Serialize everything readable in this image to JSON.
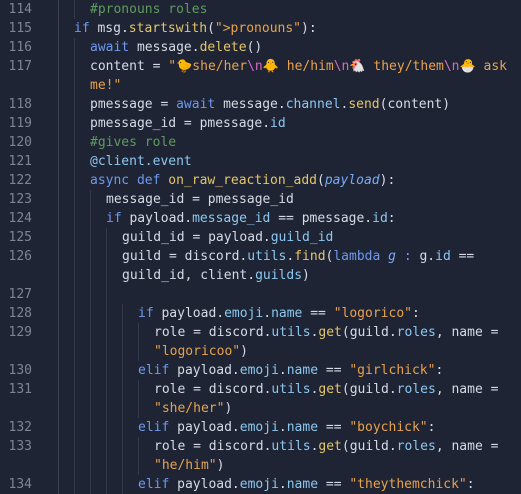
{
  "colors": {
    "background": "#1e2433",
    "line_number": "#7d8595",
    "text": "#d5dbe5",
    "comment": "#5f9a5f",
    "keyword": "#6f98ee",
    "function": "#e4c56b",
    "string": "#e8a24e",
    "escape": "#d768c7",
    "attribute": "#8cc7f0"
  },
  "lines": [
    {
      "n": "114",
      "indent": 1,
      "tokens": [
        [
          "#pronouns roles",
          "comment"
        ]
      ]
    },
    {
      "n": "115",
      "indent": 0,
      "tokens": [
        [
          "if ",
          "kw"
        ],
        [
          "msg.",
          "text"
        ],
        [
          "startswith",
          "fn"
        ],
        [
          "(",
          "text"
        ],
        [
          "\">pronouns\"",
          "str"
        ],
        [
          "):",
          "text"
        ]
      ]
    },
    {
      "n": "116",
      "indent": 1,
      "tokens": [
        [
          "await ",
          "kw"
        ],
        [
          "message.",
          "text"
        ],
        [
          "delete",
          "fn"
        ],
        [
          "()",
          "text"
        ]
      ]
    },
    {
      "n": "117",
      "indent": 1,
      "tokens": [
        [
          "content ",
          "text"
        ],
        [
          "= ",
          "op"
        ],
        [
          "\"🐤she/her",
          "str"
        ],
        [
          "\\n",
          "esc"
        ],
        [
          "🐥 he/him",
          "str"
        ],
        [
          "\\n",
          "esc"
        ],
        [
          "🐔 they/them",
          "str"
        ],
        [
          "\\n",
          "esc"
        ],
        [
          "🐣 ask",
          "str"
        ]
      ]
    },
    {
      "n": "",
      "indent": 1,
      "tokens": [
        [
          "me!\"",
          "str"
        ]
      ]
    },
    {
      "n": "118",
      "indent": 1,
      "tokens": [
        [
          "pmessage ",
          "text"
        ],
        [
          "= ",
          "op"
        ],
        [
          "await ",
          "kw"
        ],
        [
          "message.",
          "text"
        ],
        [
          "channel",
          "attr"
        ],
        [
          ".",
          "text"
        ],
        [
          "send",
          "fn"
        ],
        [
          "(content)",
          "text"
        ]
      ]
    },
    {
      "n": "119",
      "indent": 1,
      "tokens": [
        [
          "pmessage_id ",
          "text"
        ],
        [
          "= ",
          "op"
        ],
        [
          "pmessage.",
          "text"
        ],
        [
          "id",
          "attr"
        ]
      ]
    },
    {
      "n": "120",
      "indent": 1,
      "tokens": [
        [
          "#gives role",
          "comment"
        ]
      ]
    },
    {
      "n": "121",
      "indent": 1,
      "tokens": [
        [
          "@client.event",
          "attr"
        ]
      ]
    },
    {
      "n": "122",
      "indent": 1,
      "tokens": [
        [
          "async ",
          "kw"
        ],
        [
          "def ",
          "kw"
        ],
        [
          "on_raw_reaction_add",
          "fn"
        ],
        [
          "(",
          "text"
        ],
        [
          "payload",
          "ital"
        ],
        [
          "):",
          "text"
        ]
      ]
    },
    {
      "n": "123",
      "indent": 2,
      "tokens": [
        [
          "message_id ",
          "text"
        ],
        [
          "= ",
          "op"
        ],
        [
          "pmessage_id",
          "text"
        ]
      ]
    },
    {
      "n": "124",
      "indent": 2,
      "tokens": [
        [
          "if ",
          "kw"
        ],
        [
          "payload.",
          "text"
        ],
        [
          "message_id ",
          "attr"
        ],
        [
          "== ",
          "op"
        ],
        [
          "pmessage.",
          "text"
        ],
        [
          "id",
          "attr"
        ],
        [
          ":",
          "text"
        ]
      ]
    },
    {
      "n": "125",
      "indent": 3,
      "tokens": [
        [
          "guild_id ",
          "text"
        ],
        [
          "= ",
          "op"
        ],
        [
          "payload.",
          "text"
        ],
        [
          "guild_id",
          "attr"
        ]
      ]
    },
    {
      "n": "126",
      "indent": 3,
      "tokens": [
        [
          "guild ",
          "text"
        ],
        [
          "= ",
          "op"
        ],
        [
          "discord.",
          "text"
        ],
        [
          "utils",
          "attr"
        ],
        [
          ".",
          "text"
        ],
        [
          "find",
          "fn"
        ],
        [
          "(",
          "text"
        ],
        [
          "lambda ",
          "kw"
        ],
        [
          "g ",
          "ital"
        ],
        [
          ": ",
          "kw"
        ],
        [
          "g.",
          "text"
        ],
        [
          "id ",
          "attr"
        ],
        [
          "==",
          "op"
        ]
      ]
    },
    {
      "n": "",
      "indent": 3,
      "tokens": [
        [
          "guild_id, client.",
          "text"
        ],
        [
          "guilds",
          "attr"
        ],
        [
          ")",
          "text"
        ]
      ]
    },
    {
      "n": "127",
      "indent": 3,
      "tokens": []
    },
    {
      "n": "128",
      "indent": 4,
      "tokens": [
        [
          "if ",
          "kw"
        ],
        [
          "payload.",
          "text"
        ],
        [
          "emoji",
          "attr"
        ],
        [
          ".",
          "text"
        ],
        [
          "name ",
          "attr"
        ],
        [
          "== ",
          "op"
        ],
        [
          "\"logorico\"",
          "str"
        ],
        [
          ":",
          "text"
        ]
      ]
    },
    {
      "n": "129",
      "indent": 5,
      "tokens": [
        [
          "role ",
          "text"
        ],
        [
          "= ",
          "op"
        ],
        [
          "discord.",
          "text"
        ],
        [
          "utils",
          "attr"
        ],
        [
          ".",
          "text"
        ],
        [
          "get",
          "fn"
        ],
        [
          "(guild.",
          "text"
        ],
        [
          "roles",
          "attr"
        ],
        [
          ", name ",
          "text"
        ],
        [
          "=",
          "op"
        ]
      ]
    },
    {
      "n": "",
      "indent": 5,
      "tokens": [
        [
          "\"logoricoo\"",
          "str"
        ],
        [
          ")",
          "text"
        ]
      ]
    },
    {
      "n": "130",
      "indent": 4,
      "tokens": [
        [
          "elif ",
          "kw"
        ],
        [
          "payload.",
          "text"
        ],
        [
          "emoji",
          "attr"
        ],
        [
          ".",
          "text"
        ],
        [
          "name ",
          "attr"
        ],
        [
          "== ",
          "op"
        ],
        [
          "\"girlchick\"",
          "str"
        ],
        [
          ":",
          "text"
        ]
      ]
    },
    {
      "n": "131",
      "indent": 5,
      "tokens": [
        [
          "role ",
          "text"
        ],
        [
          "= ",
          "op"
        ],
        [
          "discord.",
          "text"
        ],
        [
          "utils",
          "attr"
        ],
        [
          ".",
          "text"
        ],
        [
          "get",
          "fn"
        ],
        [
          "(guild.",
          "text"
        ],
        [
          "roles",
          "attr"
        ],
        [
          ", name ",
          "text"
        ],
        [
          "=",
          "op"
        ]
      ]
    },
    {
      "n": "",
      "indent": 5,
      "tokens": [
        [
          "\"she/her\"",
          "str"
        ],
        [
          ")",
          "text"
        ]
      ]
    },
    {
      "n": "132",
      "indent": 4,
      "tokens": [
        [
          "elif ",
          "kw"
        ],
        [
          "payload.",
          "text"
        ],
        [
          "emoji",
          "attr"
        ],
        [
          ".",
          "text"
        ],
        [
          "name ",
          "attr"
        ],
        [
          "== ",
          "op"
        ],
        [
          "\"boychick\"",
          "str"
        ],
        [
          ":",
          "text"
        ]
      ]
    },
    {
      "n": "133",
      "indent": 5,
      "tokens": [
        [
          "role ",
          "text"
        ],
        [
          "= ",
          "op"
        ],
        [
          "discord.",
          "text"
        ],
        [
          "utils",
          "attr"
        ],
        [
          ".",
          "text"
        ],
        [
          "get",
          "fn"
        ],
        [
          "(guild.",
          "text"
        ],
        [
          "roles",
          "attr"
        ],
        [
          ", name ",
          "text"
        ],
        [
          "=",
          "op"
        ]
      ]
    },
    {
      "n": "",
      "indent": 5,
      "tokens": [
        [
          "\"he/him\"",
          "str"
        ],
        [
          ")",
          "text"
        ]
      ]
    },
    {
      "n": "134",
      "indent": 4,
      "tokens": [
        [
          "elif ",
          "kw"
        ],
        [
          "payload.",
          "text"
        ],
        [
          "emoji",
          "attr"
        ],
        [
          ".",
          "text"
        ],
        [
          "name ",
          "attr"
        ],
        [
          "== ",
          "op"
        ],
        [
          "\"theythemchick\"",
          "str"
        ],
        [
          ":",
          "text"
        ]
      ]
    }
  ]
}
